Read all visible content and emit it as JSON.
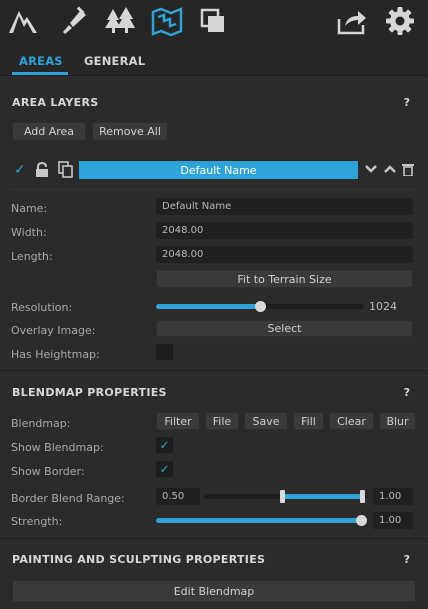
{
  "toolbar": {
    "icons": [
      "mountain-icon",
      "brush-icon",
      "trees-icon",
      "map-icon",
      "copy-windows-icon",
      "share-icon",
      "gear-icon"
    ],
    "accent": "#2fa3d8"
  },
  "tabs": [
    {
      "label": "AREAS",
      "active": true
    },
    {
      "label": "GENERAL",
      "active": false
    }
  ],
  "area_layers": {
    "title": "AREA LAYERS",
    "help": "?",
    "add_label": "Add Area",
    "remove_label": "Remove All",
    "layer_name": "Default Name"
  },
  "fields": {
    "name_label": "Name:",
    "name_value": "Default Name",
    "width_label": "Width:",
    "width_value": "2048.00",
    "length_label": "Length:",
    "length_value": "2048.00",
    "fit_label": "Fit to Terrain Size",
    "resolution_label": "Resolution:",
    "resolution_value": "1024",
    "resolution_fraction": 0.5,
    "overlay_label": "Overlay Image:",
    "select_label": "Select",
    "heightmap_label": "Has Heightmap:",
    "has_heightmap": false
  },
  "blendmap": {
    "title": "BLENDMAP PROPERTIES",
    "help": "?",
    "blendmap_label": "Blendmap:",
    "buttons": [
      "Filter",
      "File",
      "Save",
      "Fill",
      "Clear",
      "Blur"
    ],
    "show_blendmap_label": "Show Blendmap:",
    "show_blendmap": true,
    "show_border_label": "Show Border:",
    "show_border": true,
    "border_range_label": "Border Blend Range:",
    "border_min": "0.50",
    "border_max": "1.00",
    "strength_label": "Strength:",
    "strength_value": "1.00",
    "strength_fraction": 1.0
  },
  "painting": {
    "title": "PAINTING AND SCULPTING PROPERTIES",
    "help": "?",
    "edit_label": "Edit Blendmap"
  }
}
